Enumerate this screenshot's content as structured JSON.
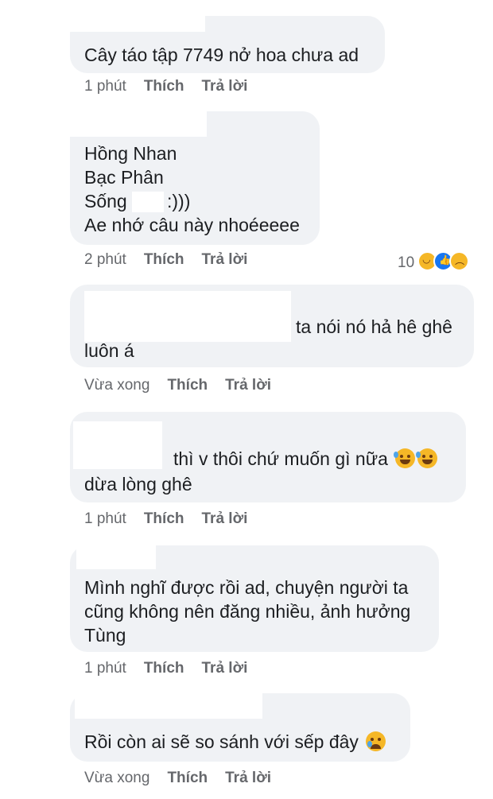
{
  "comments": [
    {
      "lines": [
        "Cây táo tập 7749 nở hoa chưa ad"
      ],
      "time": "1 phút",
      "like": "Thích",
      "reply": "Trả lời"
    },
    {
      "lines": [
        "Hồng Nhan",
        "Bạc Phân",
        "Sống",
        ":)))",
        "Ae nhớ câu này nhoéeeee"
      ],
      "time": "2 phút",
      "like": "Thích",
      "reply": "Trả lời",
      "reaction_count": "10",
      "reactions": [
        "haha-icon",
        "like-icon",
        "sad-icon"
      ]
    },
    {
      "lines": [
        "ta nói nó hả hê ghê",
        "luôn á"
      ],
      "time": "Vừa xong",
      "like": "Thích",
      "reply": "Trả lời"
    },
    {
      "lines": [
        "thì v thôi chứ muốn gì nữa",
        "dừa lòng ghê"
      ],
      "emoji": [
        "rofl-icon",
        "rofl-icon"
      ],
      "time": "1 phút",
      "like": "Thích",
      "reply": "Trả lời"
    },
    {
      "lines": [
        "Mình nghĩ được rồi ad, chuyện người ta",
        "cũng không nên đăng nhiều, ảnh hưởng",
        "Tùng"
      ],
      "time": "1 phút",
      "like": "Thích",
      "reply": "Trả lời"
    },
    {
      "lines": [
        "Rồi còn ai sẽ so sánh với sếp đây"
      ],
      "emoji": [
        "crying-face-icon"
      ],
      "time": "Vừa xong",
      "like": "Thích",
      "reply": "Trả lời"
    }
  ],
  "colors": {
    "bubble": "#f0f2f5",
    "meta": "#65676b",
    "like_blue": "#1877f2",
    "emoji_yellow": "#f5b727"
  }
}
